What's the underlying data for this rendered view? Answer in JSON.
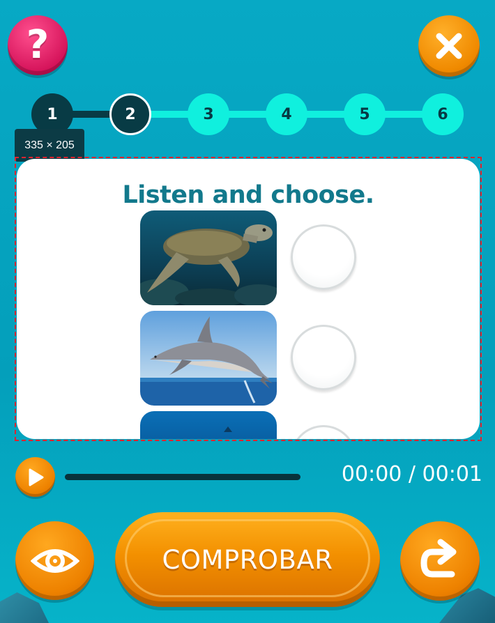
{
  "header": {
    "help_icon": "question-icon",
    "close_icon": "close-icon",
    "help_glyph": "?"
  },
  "steps": [
    {
      "label": "1",
      "state": "done"
    },
    {
      "label": "2",
      "state": "current"
    },
    {
      "label": "3",
      "state": "todo"
    },
    {
      "label": "4",
      "state": "todo"
    },
    {
      "label": "5",
      "state": "todo"
    },
    {
      "label": "6",
      "state": "todo"
    }
  ],
  "size_tag": "335 × 205",
  "card": {
    "title": "Listen and choose.",
    "options": [
      {
        "image": "sea turtle",
        "selected": false
      },
      {
        "image": "dolphin",
        "selected": false
      },
      {
        "image": "blue sea",
        "selected": false
      }
    ]
  },
  "audio": {
    "play_icon": "play-icon",
    "time": "00:00 / 00:01",
    "progress": 0
  },
  "footer": {
    "check_label": "COMPROBAR",
    "show_icon": "eye-icon",
    "next_icon": "redo-arrow-icon"
  },
  "colors": {
    "background": "#049fbb",
    "accent_orange": "#f08a00",
    "help_pink": "#d5135a",
    "step_done": "#083b45",
    "step_todo": "#10f0de",
    "title": "#12798c"
  }
}
